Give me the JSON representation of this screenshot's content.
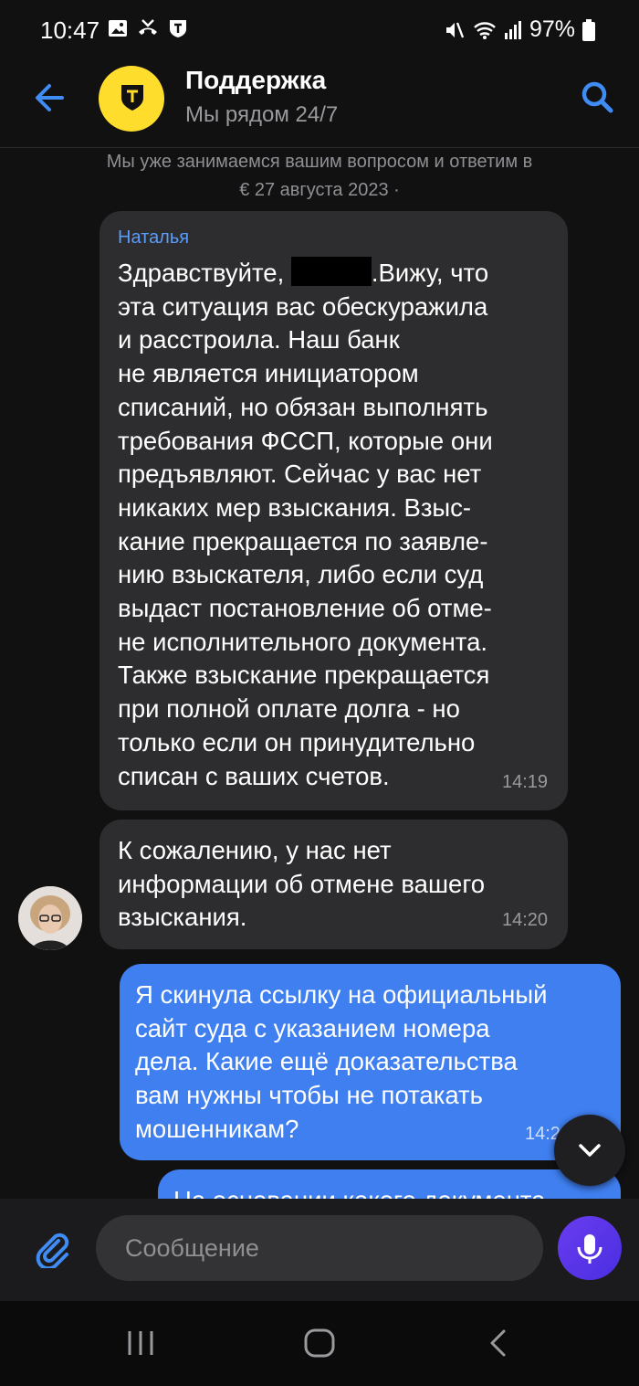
{
  "status_bar": {
    "time": "10:47",
    "battery": "97%",
    "left_icons": [
      "image-icon",
      "missed-call-icon",
      "shield-app-icon"
    ],
    "right_icons": [
      "mute-icon",
      "wifi-icon",
      "signal-icon",
      "battery-icon"
    ]
  },
  "header": {
    "title": "Поддержка",
    "subtitle": "Мы рядом 24/7",
    "brand_color": "#ffdd2d"
  },
  "system_notice": {
    "line1": "Мы уже занимаемся вашим вопросом и ответим в",
    "line2": "€ 27 августа 2023  ·"
  },
  "messages": [
    {
      "direction": "incoming",
      "sender": "Наталья",
      "line1_pre": "Здравствуйте, ",
      "line1_post": ".Вижу, что",
      "lines": [
        "эта ситуация вас обескуражила",
        "и расстроила. Наш банк",
        "не является инициатором",
        "списаний, но обязан выполнять",
        "требования ФССП, которые они",
        "предъявляют. Сейчас у вас нет",
        "никаких мер взыскания. Взыс-",
        "кание прекращается по заявле-",
        "нию взыскателя, либо если суд",
        "выдаст постановление об отме-",
        "не исполнительного документа.",
        "Также взыскание прекращается",
        "при полной оплате долга - но",
        "только если он принудительно",
        "списан с ваших счетов."
      ],
      "time": "14:19"
    },
    {
      "direction": "incoming",
      "lines": [
        "К сожалению, у нас нет",
        "информации об отмене вашего",
        "взыскания."
      ],
      "time": "14:20"
    },
    {
      "direction": "outgoing",
      "lines": [
        "Я скинула ссылку на официальный",
        "сайт суда с указанием номера",
        "дела. Какие ещё доказательства",
        "вам нужны чтобы не потакать",
        "мошенникам?"
      ],
      "time": "14:2"
    },
    {
      "direction": "outgoing",
      "lines": [
        "На основании какого документа"
      ]
    }
  ],
  "composer": {
    "placeholder": "Сообщение"
  },
  "colors": {
    "incoming_bubble": "#2d2d2f",
    "outgoing_bubble": "#3f7ff0",
    "accent": "#3f8cf5"
  }
}
